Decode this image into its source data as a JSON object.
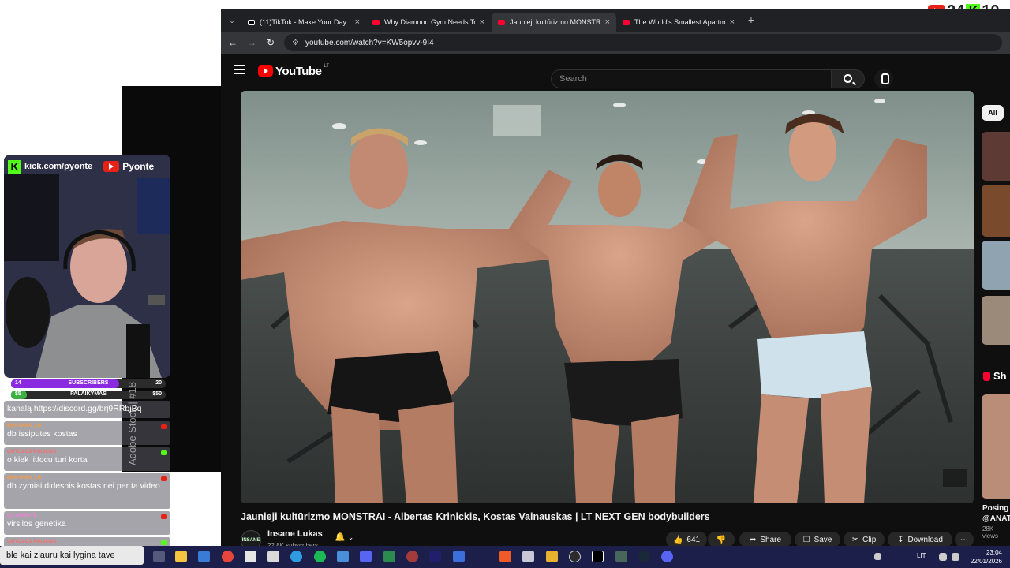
{
  "corner_logo": {
    "number1": "24",
    "number2": "10"
  },
  "browser": {
    "tabs": [
      {
        "label": "(11)TikTok - Make Your Day",
        "icon": "tiktok-icon"
      },
      {
        "label": "Why Diamond Gym Needs To B",
        "icon": "youtube-icon"
      },
      {
        "label": "Jaunieji kultūrizmo MONSTRAI",
        "icon": "youtube-icon"
      },
      {
        "label": "The World's Smallest Apartmen",
        "icon": "youtube-icon"
      }
    ],
    "active_tab": 2,
    "url": "youtube.com/watch?v=KW5opvv-9I4"
  },
  "youtube": {
    "logo_text": "YouTube",
    "country_code": "LT",
    "search_placeholder": "Search",
    "video_title": "Jaunieji kultūrizmo MONSTRAI - Albertas Krinickis, Kostas Vainauskas | LT NEXT GEN bodybuilders",
    "channel": {
      "name": "Insane Lukas",
      "subscribers": "22,8K subscribers",
      "avatar_text": "INSANE"
    },
    "actions": {
      "likes": "641",
      "share": "Share",
      "save": "Save",
      "clip": "Clip",
      "download": "Download"
    },
    "sidebar": {
      "chip": "All",
      "shorts_label": "Sh",
      "short_caption_line1": "Posing",
      "short_caption_line2": "@ANAT",
      "short_views": "28K views"
    }
  },
  "stream_overlay": {
    "kick_url": "kick.com/pyonte",
    "youtube_name": "Pyonte",
    "goals": [
      {
        "left": "14",
        "label": "SUBSCRIBERS",
        "right": "20",
        "progress": 0.7,
        "color": "#8a2be2"
      },
      {
        "left": "$5",
        "label": "PALAIKYMAS",
        "right": "$50",
        "progress": 0.1,
        "color": "#3cb043"
      }
    ],
    "watermark": "Adobe Stock | #18"
  },
  "chat": [
    {
      "author": "",
      "text": "kanalą https://discord.gg/brj9RRbjBq",
      "author_color": "#ffd36b",
      "badge": ""
    },
    {
      "author": "BOOYAKA_LB",
      "text": "db issiputes kostas",
      "author_color": "#ff9a3d",
      "badge": "youtube"
    },
    {
      "author": "LIETUVOS POLICIJA",
      "text": "o kiek litfocu turi korta",
      "author_color": "#ff6b6b",
      "badge": "kick"
    },
    {
      "author": "BOOYAKA_LB",
      "text": "db zymiai didesnis kostas nei per ta video",
      "author_color": "#ff9a3d",
      "badge": "youtube"
    },
    {
      "author": "@CAPRIXTE",
      "text": "virsilos genetika",
      "author_color": "#ff7ad9",
      "badge": "youtube"
    },
    {
      "author": "LIETUVOS POLICIJA",
      "text": "",
      "author_color": "#ff6b6b",
      "badge": "kick"
    }
  ],
  "taskbar": {
    "input_text": "ble kai ziauru kai lygina tave",
    "language": "LIT",
    "time": "23:04",
    "date": "22/01/2026"
  },
  "colors": {
    "youtube_red": "#ff0000",
    "kick_green": "#53fc18",
    "yt_dark": "#0f0f0f",
    "taskbar": "#1c1f4a"
  }
}
